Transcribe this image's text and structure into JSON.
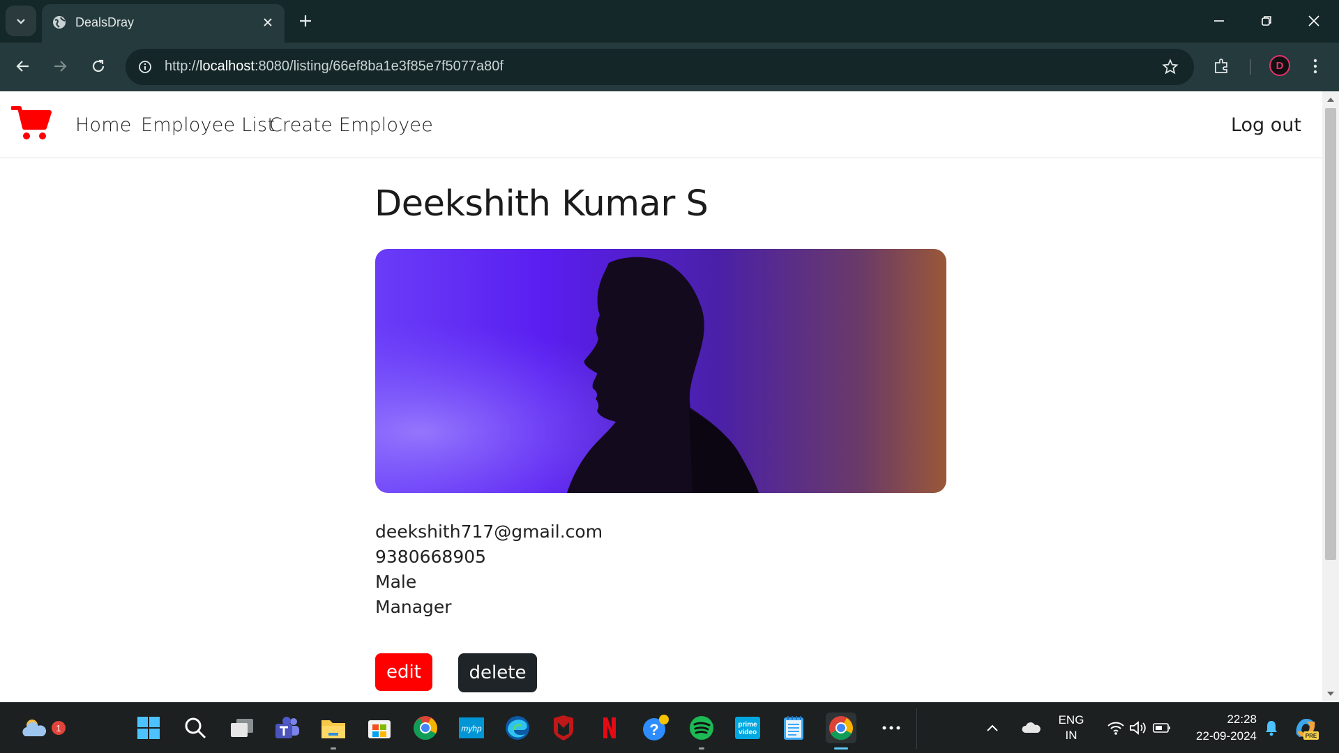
{
  "browser": {
    "tab_title": "DealsDray",
    "url_prefix": "http://",
    "url_host": "localhost",
    "url_rest": ":8080/listing/66ef8ba1e3f85e7f5077a80f"
  },
  "navbar": {
    "brand_icon": "shopping-cart-icon",
    "brand_color": "#ff0000",
    "links": [
      {
        "label": "Home"
      },
      {
        "label": "Employee List"
      },
      {
        "label": "Create Employee"
      }
    ],
    "logout_label": "Log out"
  },
  "employee": {
    "name": "Deekshith Kumar S",
    "email": "deekshith717@gmail.com",
    "phone": "9380668905",
    "gender": "Male",
    "designation": "Manager"
  },
  "actions": {
    "edit_label": "edit",
    "delete_label": "delete",
    "edit_color": "#ff0000",
    "delete_color": "#1f2428"
  },
  "taskbar": {
    "weather_badge": "1",
    "apps": [
      "start-icon",
      "search-icon",
      "task-view-icon",
      "teams-icon",
      "file-explorer-icon",
      "microsoft-store-icon",
      "chrome-icon",
      "myhp-icon",
      "edge-icon",
      "mcafee-icon",
      "netflix-icon",
      "help-icon",
      "spotify-icon",
      "prime-video-icon",
      "notepad-icon",
      "chrome-active-icon",
      "more-icon"
    ],
    "myhp_label": "myhp",
    "prime_label_1": "prime",
    "prime_label_2": "video",
    "language_line1": "ENG",
    "language_line2": "IN",
    "time": "22:28",
    "date": "22-09-2024",
    "copilot_badge": "PRE"
  }
}
